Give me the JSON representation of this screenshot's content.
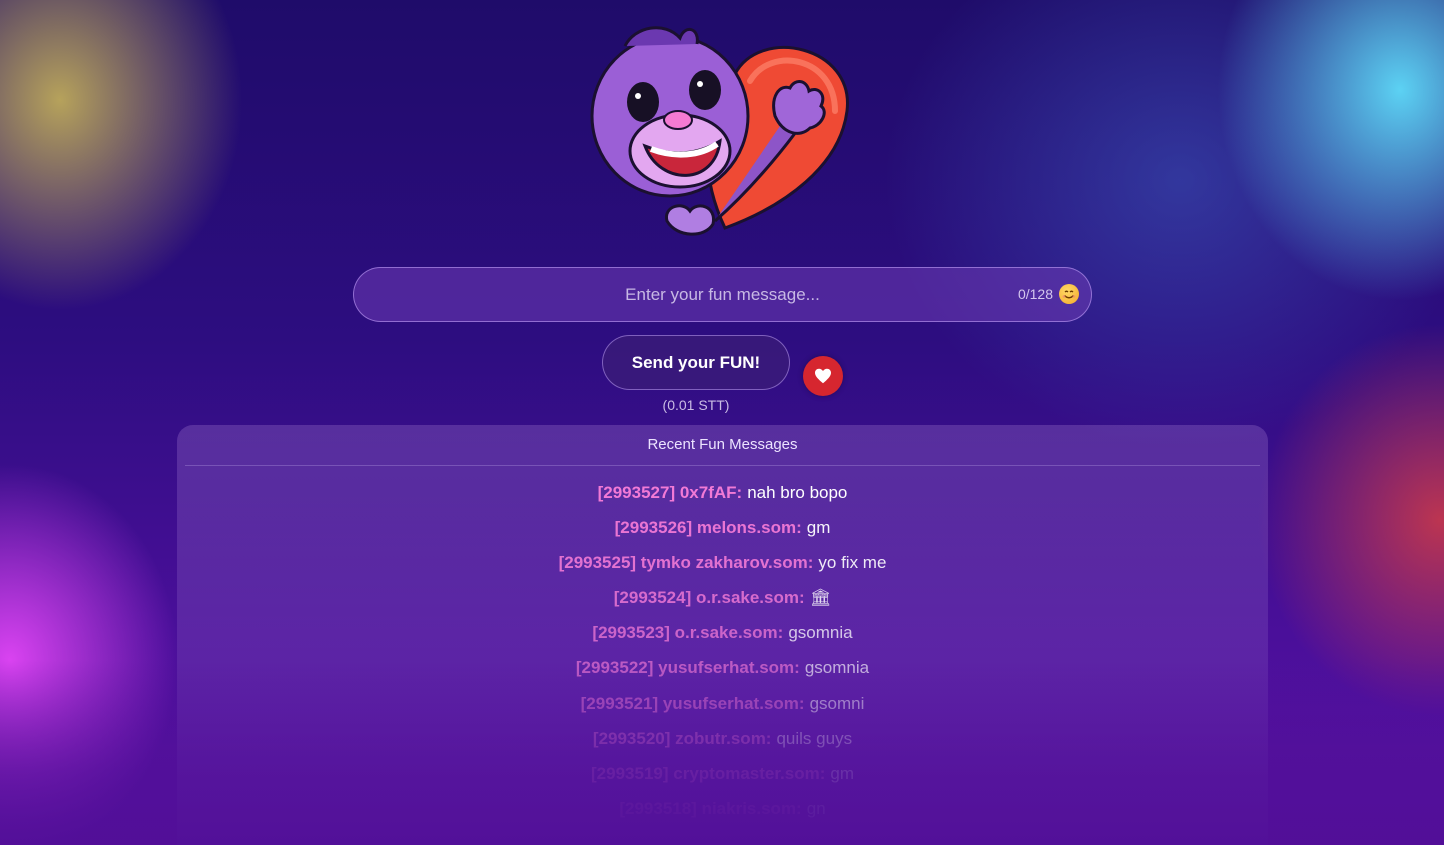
{
  "input": {
    "placeholder": "Enter your fun message...",
    "counter": "0/128",
    "emoji_icon": "smiling-emoji-icon"
  },
  "send": {
    "label": "Send your FUN!",
    "price": "(0.01 STT)"
  },
  "like": {
    "icon": "heart-icon"
  },
  "panel": {
    "title": "Recent Fun Messages",
    "messages": [
      {
        "meta": "[2993527] 0x7fAF:",
        "text": "nah bro bopo",
        "opacity": 1.0
      },
      {
        "meta": "[2993526] melons.som:",
        "text": "gm",
        "opacity": 0.95
      },
      {
        "meta": "[2993525] tymko zakharov.som:",
        "text": "yo fix me",
        "opacity": 0.9
      },
      {
        "meta": "[2993524] o.r.sake.som:",
        "text": "🏛",
        "opacity": 0.82
      },
      {
        "meta": "[2993523] o.r.sake.som:",
        "text": "gsomnia",
        "opacity": 0.74
      },
      {
        "meta": "[2993522] yusufserhat.som:",
        "text": "gsomnia",
        "opacity": 0.66
      },
      {
        "meta": "[2993521] yusufserhat.som:",
        "text": "gsomni",
        "opacity": 0.56
      },
      {
        "meta": "[2993520] zobutr.som:",
        "text": "quils guys",
        "opacity": 0.44
      },
      {
        "meta": "[2993519] cryptomaster.som:",
        "text": "gm",
        "opacity": 0.3
      },
      {
        "meta": "[2993518] niakris.som:",
        "text": "gn",
        "opacity": 0.18
      }
    ]
  },
  "colors": {
    "accent_pink": "#f27ad6",
    "heart_red": "#d6262f"
  }
}
